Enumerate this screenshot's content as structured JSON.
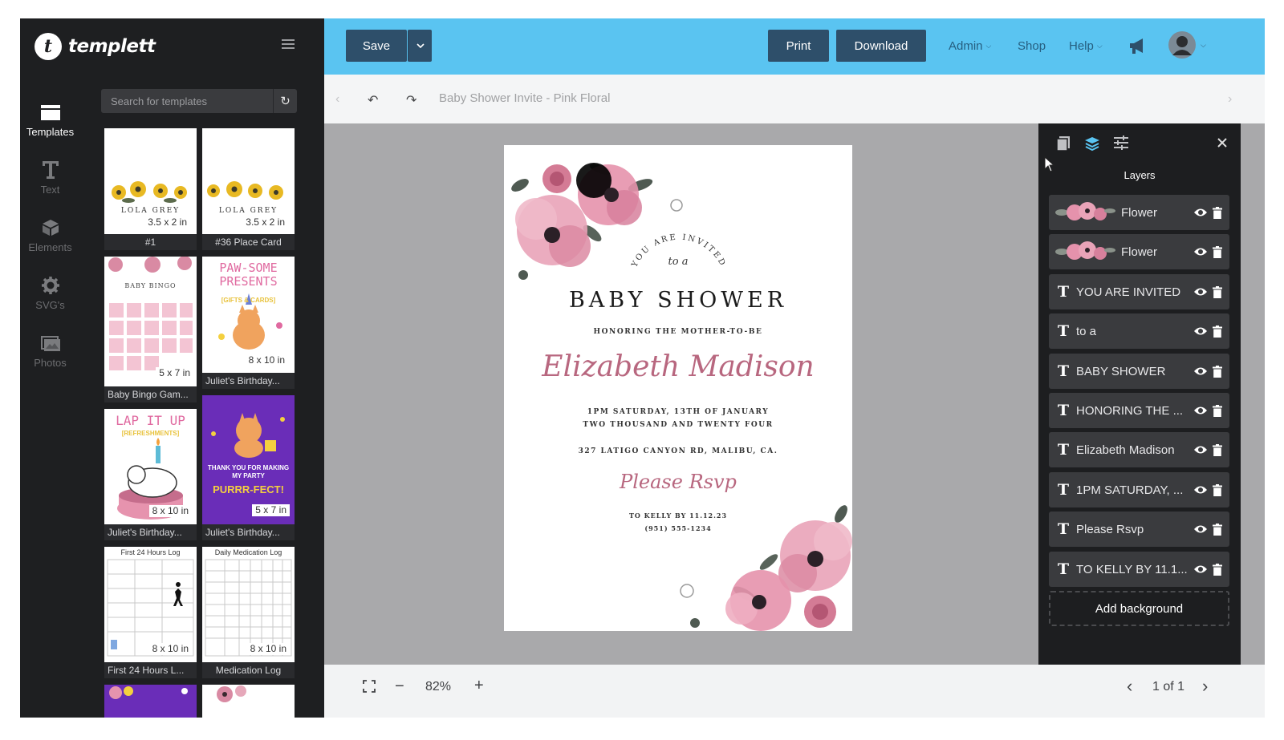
{
  "brand": {
    "name": "templett",
    "logo_letter": "t"
  },
  "nav": [
    {
      "label": "Templates",
      "icon": "templates-icon"
    },
    {
      "label": "Text",
      "icon": "text-icon"
    },
    {
      "label": "Elements",
      "icon": "elements-icon"
    },
    {
      "label": "SVG's",
      "icon": "gear-icon"
    },
    {
      "label": "Photos",
      "icon": "photos-icon"
    }
  ],
  "search": {
    "placeholder": "Search for templates"
  },
  "templates": [
    {
      "caption": "#1",
      "size": "3.5 x 2 in",
      "card_text": "LOLA GREY"
    },
    {
      "caption": "#36 Place Card",
      "size": "3.5 x 2 in",
      "card_text": "LOLA GREY"
    },
    {
      "caption": "Baby Bingo Gam...",
      "size": "5 x 7 in",
      "card_text": "BABY BINGO"
    },
    {
      "caption": "Juliet's Birthday...",
      "size": "8 x 10 in",
      "card_text": "PAW-SOME PRESENTS",
      "card_sub": "[GIFTS & CARDS]"
    },
    {
      "caption": "Juliet's Birthday...",
      "size": "8 x 10 in",
      "card_text": "LAP IT UP",
      "card_sub": "[REFRESHMENTS]"
    },
    {
      "caption": "Juliet's Birthday...",
      "size": "5 x 7 in",
      "card_text": "THANK YOU FOR MAKING MY PARTY",
      "card_sub": "PURRR-FECT!"
    },
    {
      "caption": "First 24 Hours L...",
      "size": "8 x 10 in",
      "card_text": "First 24 Hours Log"
    },
    {
      "caption": "Medication Log",
      "size": "8 x 10 in",
      "card_text": "Daily Medication Log"
    }
  ],
  "topbar": {
    "save": "Save",
    "print": "Print",
    "download": "Download",
    "admin": "Admin",
    "shop": "Shop",
    "help": "Help"
  },
  "document": {
    "title": "Baby Shower Invite - Pink Floral"
  },
  "invite": {
    "you_are_invited": "YOU ARE INVITED",
    "to_a": "to a",
    "headline": "BABY SHOWER",
    "honoring": "HONORING THE MOTHER-TO-BE",
    "name": "Elizabeth Madison",
    "date_line1": "1PM SATURDAY, 13TH OF JANUARY",
    "date_line2": "TWO THOUSAND AND TWENTY FOUR",
    "address": "327 LATIGO CANYON RD, MALIBU, CA.",
    "rsvp": "Please Rsvp",
    "rsvp_to": "TO KELLY BY 11.12.23",
    "phone": "(951) 555-1234"
  },
  "layers_panel": {
    "title": "Layers",
    "items": [
      {
        "type": "image",
        "label": "Flower"
      },
      {
        "type": "image",
        "label": "Flower"
      },
      {
        "type": "text",
        "label": "YOU ARE INVITED"
      },
      {
        "type": "text",
        "label": "to a"
      },
      {
        "type": "text",
        "label": "BABY SHOWER"
      },
      {
        "type": "text",
        "label": "HONORING THE ..."
      },
      {
        "type": "text",
        "label": "Elizabeth Madison"
      },
      {
        "type": "text",
        "label": "1PM SATURDAY, ..."
      },
      {
        "type": "text",
        "label": "Please Rsvp"
      },
      {
        "type": "text",
        "label": "TO KELLY BY 11.1..."
      }
    ],
    "add_background": "Add background"
  },
  "bottombar": {
    "zoom": "82%",
    "page": "1 of 1"
  },
  "colors": {
    "topbar": "#5ac4f1",
    "button": "#2e4f6a",
    "panel": "#1d1e20",
    "sidebar": "#1e1f21",
    "accent_pink": "#b8677f"
  }
}
